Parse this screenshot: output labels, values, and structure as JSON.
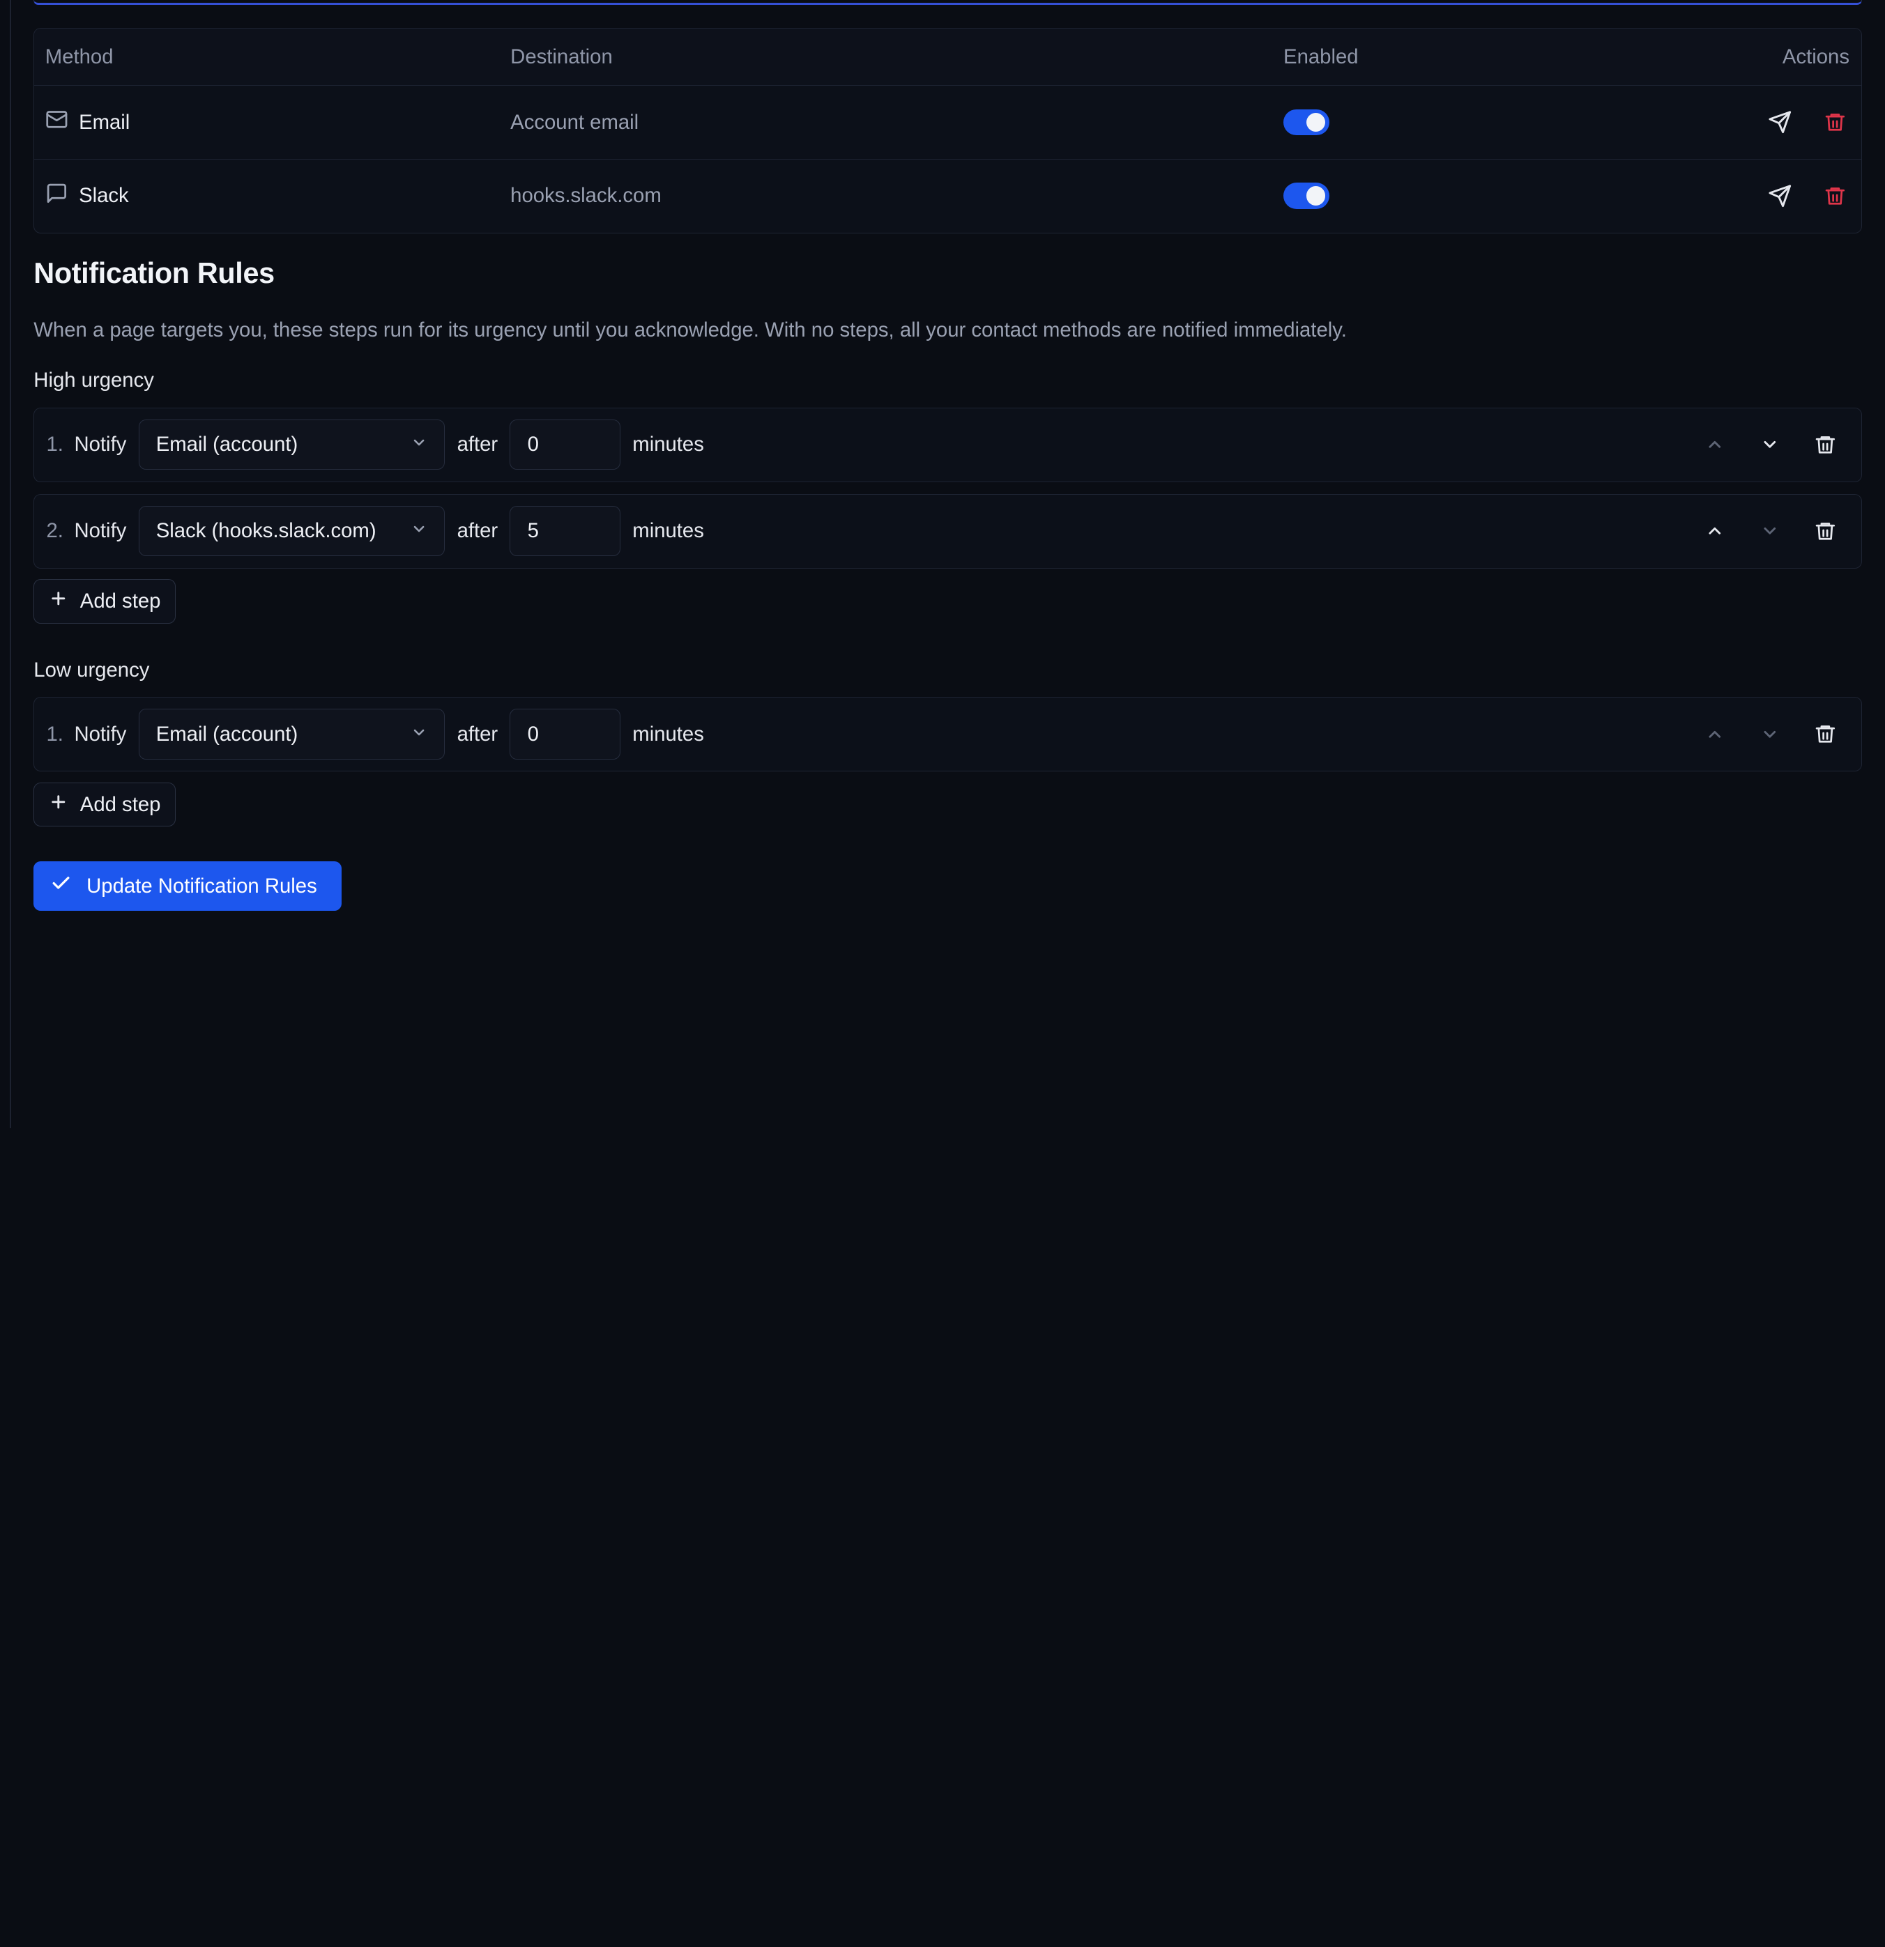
{
  "contact_table": {
    "headers": {
      "method": "Method",
      "destination": "Destination",
      "enabled": "Enabled",
      "actions": "Actions"
    },
    "rows": [
      {
        "method": "Email",
        "icon": "mail-icon",
        "destination": "Account email",
        "enabled": true
      },
      {
        "method": "Slack",
        "icon": "message-icon",
        "destination": "hooks.slack.com",
        "enabled": true
      }
    ]
  },
  "rules": {
    "title": "Notification Rules",
    "description": "When a page targets you, these steps run for its urgency until you acknowledge. With no steps, all your contact methods are notified immediately.",
    "high": {
      "title": "High urgency",
      "steps": [
        {
          "num": "1.",
          "notify": "Notify",
          "method": "Email (account)",
          "after": "after",
          "delay": "0",
          "minutes": "minutes"
        },
        {
          "num": "2.",
          "notify": "Notify",
          "method": "Slack (hooks.slack.com)",
          "after": "after",
          "delay": "5",
          "minutes": "minutes"
        }
      ],
      "add_label": "Add step"
    },
    "low": {
      "title": "Low urgency",
      "steps": [
        {
          "num": "1.",
          "notify": "Notify",
          "method": "Email (account)",
          "after": "after",
          "delay": "0",
          "minutes": "minutes"
        }
      ],
      "add_label": "Add step"
    },
    "submit_label": "Update Notification Rules"
  },
  "colors": {
    "accent": "#1d57ee",
    "danger": "#e0354a",
    "background": "#0a0d14"
  }
}
